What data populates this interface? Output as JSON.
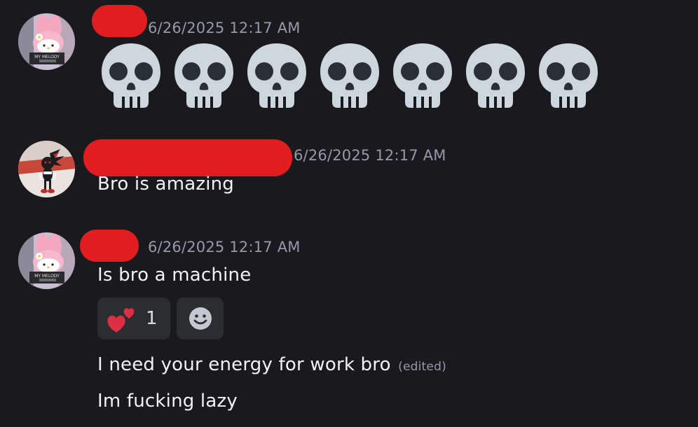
{
  "messages": [
    {
      "avatar_icon": "my-melody-avatar-icon",
      "avatar_text": "MY MELODY",
      "timestamp": "6/26/2025 12:17 AM",
      "emoji": "skull-icon",
      "emoji_count": 7
    },
    {
      "avatar_icon": "shadow-hedgehog-avatar-icon",
      "timestamp": "6/26/2025 12:17 AM",
      "text": "Bro is amazing"
    },
    {
      "avatar_icon": "my-melody-avatar-icon",
      "avatar_text": "MY MELODY",
      "timestamp": "6/26/2025 12:17 AM",
      "text": "Is bro a machine",
      "reaction": {
        "emoji": "two-hearts-icon",
        "count": "1"
      },
      "add_reaction_icon": "smiley-icon"
    },
    {
      "text": "I need your energy for work bro",
      "edited_label": "(edited)"
    },
    {
      "text": "Im fucking lazy"
    }
  ],
  "colors": {
    "background": "#1a1a1e",
    "redaction": "#e11d1f",
    "timestamp": "#949ba4",
    "message_text": "#f2f3f5",
    "reaction_bg": "#2b2d31"
  }
}
